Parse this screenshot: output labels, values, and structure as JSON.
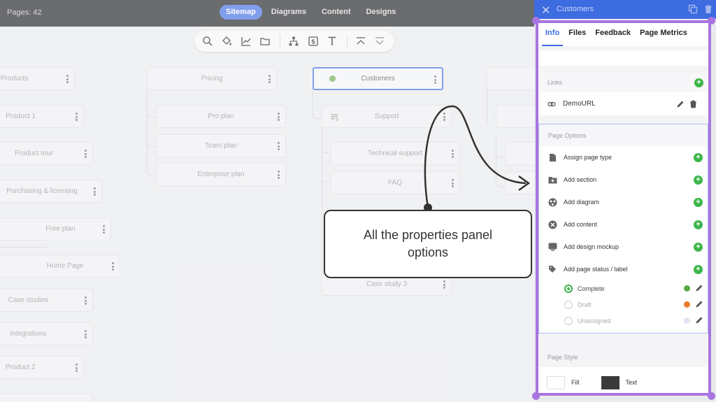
{
  "topbar": {
    "pages_count": "Pages: 42",
    "nav": [
      "Sitemap",
      "Diagrams",
      "Content",
      "Designs"
    ],
    "active_nav": "Sitemap",
    "accent": "#3d6be0"
  },
  "toolbar": {
    "icons": [
      "search-icon",
      "paint-bucket-icon",
      "chart-icon",
      "folder-icon",
      "sitemap-icon",
      "dollar-box-icon",
      "text-icon",
      "collapse-up-icon",
      "expand-down-icon"
    ]
  },
  "sitemap": {
    "col1": [
      "Products",
      "Product 1",
      "Product tour",
      "Purchasing & licensing",
      "Free plan",
      "Home Page",
      "Case studies",
      "Integrations",
      "Product 2"
    ],
    "col2": [
      "Pricing",
      "Pro plan",
      "Team plan",
      "Enterprise plan"
    ],
    "col3": [
      "Customers",
      "Support",
      "Technical support",
      "FAQ",
      "Case study 3"
    ]
  },
  "callout": {
    "text": "All the properties panel options"
  },
  "panel": {
    "header_title": "Customers",
    "tabs": [
      "Info",
      "Files",
      "Feedback",
      "Page Metrics"
    ],
    "active_tab": "Info",
    "links_label": "Links",
    "link_name": "DemoURL",
    "page_options_label": "Page Options",
    "options": [
      {
        "label": "Assign page type",
        "icon": "page-icon"
      },
      {
        "label": "Add section",
        "icon": "folder-plus-icon"
      },
      {
        "label": "Add diagram",
        "icon": "diagram-icon"
      },
      {
        "label": "Add content",
        "icon": "content-icon"
      },
      {
        "label": "Add design mockup",
        "icon": "monitor-icon"
      },
      {
        "label": "Add page status / label",
        "icon": "tag-icon"
      }
    ],
    "statuses": [
      {
        "label": "Complete",
        "color": "#5aa846",
        "selected": true
      },
      {
        "label": "Draft",
        "color": "#f07a2e",
        "selected": false
      },
      {
        "label": "Unassigned",
        "color": "#e2e5f2",
        "selected": false
      }
    ],
    "page_style_label": "Page Style",
    "fill_label": "Fill",
    "text_label": "Text",
    "fill_color": "#ffffff",
    "text_color": "#3a3a3a",
    "highlight_color": "#a875e0"
  }
}
